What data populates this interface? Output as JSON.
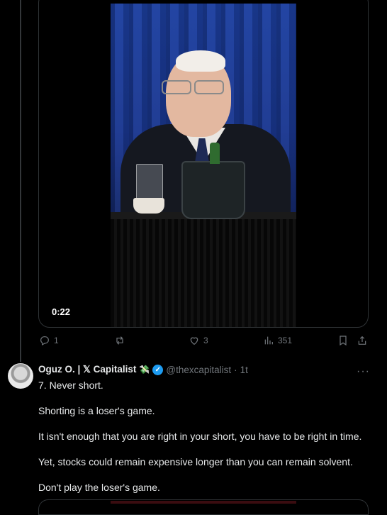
{
  "video": {
    "time": "0:22"
  },
  "actions": {
    "replies": "1",
    "reposts": "",
    "likes": "3",
    "views": "351"
  },
  "tweet": {
    "name": "Oguz O. | 𝕏 Capitalist",
    "emoji": "💸",
    "handle": "@thexcapitalist",
    "dot": "·",
    "time": "1t",
    "more": "···",
    "lines": [
      "7. Never short.",
      "Shorting is a loser's game.",
      "It isn't enough that you are right in your short, you have to be right in time.",
      "Yet, stocks could remain expensive longer than you can remain solvent.",
      "Don't play the loser's game."
    ]
  },
  "colors": {
    "accent": "#1d9bf0",
    "muted": "#71767b",
    "text": "#e7e9ea",
    "border": "#2f3336"
  }
}
